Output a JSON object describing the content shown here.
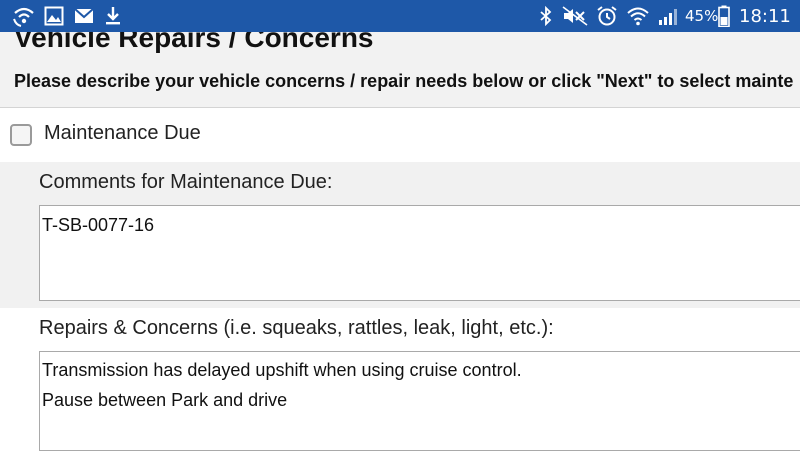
{
  "status_bar": {
    "battery_percent": "45%",
    "time": "18:11",
    "icons_left": [
      "wifi-call-icon",
      "image-icon",
      "mail-icon",
      "download-icon"
    ],
    "icons_right": [
      "bluetooth-icon",
      "mute-icon",
      "alarm-icon",
      "wifi-icon",
      "signal-icon",
      "battery-icon"
    ],
    "color": "#1e58a8"
  },
  "header": {
    "title": "Vehicle Repairs / Concerns",
    "instructions": "Please describe your vehicle concerns / repair needs below or click \"Next\" to select mainte"
  },
  "maintenance": {
    "checkbox_label": "Maintenance Due",
    "checked": false,
    "comments_label": "Comments for Maintenance Due:",
    "comments_value": "T-SB-0077-16"
  },
  "repairs": {
    "label": "Repairs & Concerns (i.e. squeaks, rattles, leak, light, etc.):",
    "value": "Transmission has delayed upshift when using cruise control.\nPause between Park and drive"
  }
}
